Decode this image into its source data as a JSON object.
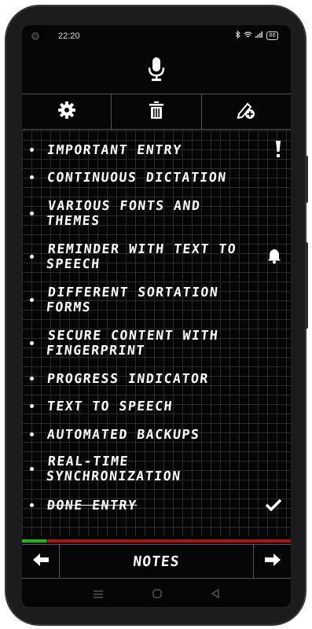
{
  "status_bar": {
    "time": "22:20",
    "battery": "86"
  },
  "list": {
    "items": [
      {
        "text": "IMPORTANT ENTRY",
        "icon": "exclamation-icon",
        "done": false
      },
      {
        "text": "CONTINUOUS DICTATION",
        "icon": "",
        "done": false
      },
      {
        "text": "VARIOUS FONTS AND THEMES",
        "icon": "",
        "done": false
      },
      {
        "text": "REMINDER WITH TEXT TO SPEECH",
        "icon": "bell-icon",
        "done": false
      },
      {
        "text": "DIFFERENT SORTATION FORMS",
        "icon": "",
        "done": false
      },
      {
        "text": "SECURE CONTENT WITH FINGERPRINT",
        "icon": "",
        "done": false
      },
      {
        "text": "PROGRESS INDICATOR",
        "icon": "",
        "done": false
      },
      {
        "text": "TEXT TO SPEECH",
        "icon": "",
        "done": false
      },
      {
        "text": "AUTOMATED BACKUPS",
        "icon": "",
        "done": false
      },
      {
        "text": "REAL-TIME SYNCHRONIZATION",
        "icon": "",
        "done": false
      },
      {
        "text": "DONE ENTRY",
        "icon": "check-icon",
        "done": true
      }
    ]
  },
  "progress": {
    "fraction": 0.09,
    "fill_color": "#18b818",
    "track_color": "#b01010"
  },
  "bottom_bar": {
    "title": "NOTES"
  }
}
